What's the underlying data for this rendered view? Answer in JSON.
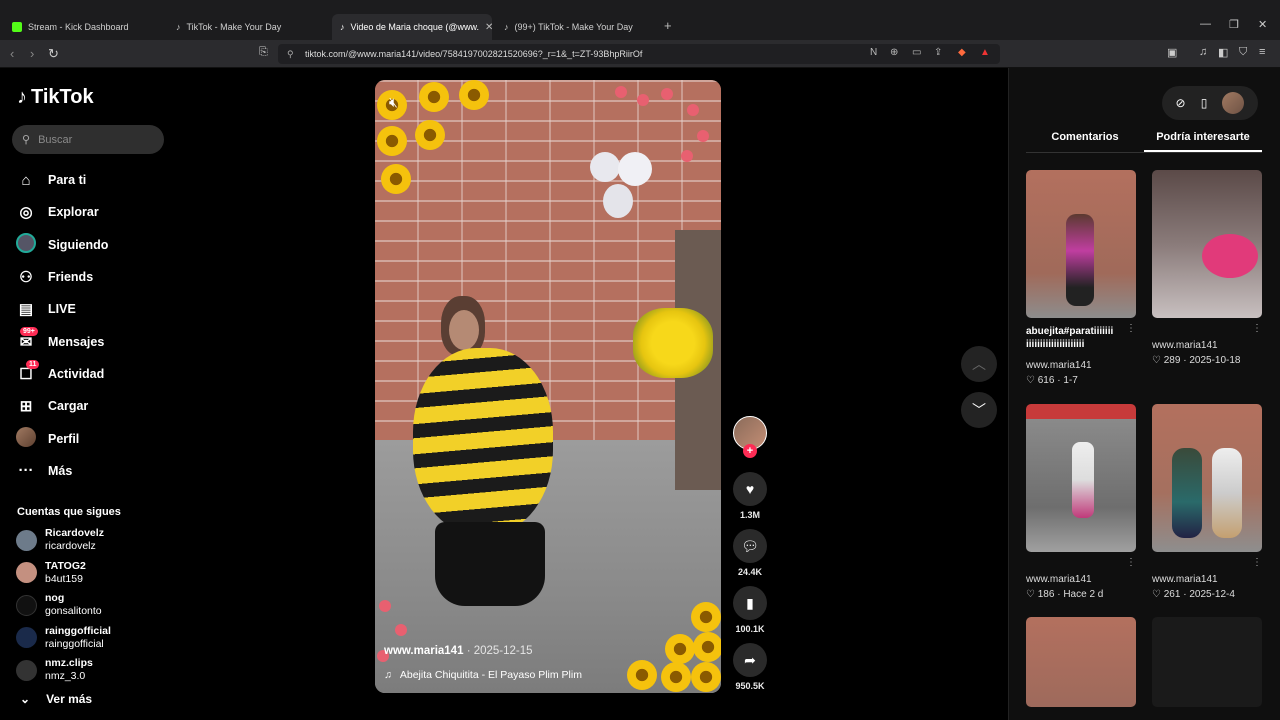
{
  "browser": {
    "tabs": [
      {
        "label": "Stream - Kick Dashboard",
        "favicon_color": "#53fc18"
      },
      {
        "label": "TikTok - Make Your Day",
        "favicon_color": "#ffffff"
      },
      {
        "label": "Video de Maria choque (@www.",
        "favicon_color": "#ffffff"
      },
      {
        "label": "(99+) TikTok - Make Your Day",
        "favicon_color": "#ffffff"
      }
    ],
    "url": "tiktok.com/@www.maria141/video/7584197002821520696?_r=1&_t=ZT-93BhpRiirOf"
  },
  "sidebar": {
    "logo": "TikTok",
    "search_placeholder": "Buscar",
    "nav": [
      {
        "label": "Para ti",
        "icon": "home-icon"
      },
      {
        "label": "Explorar",
        "icon": "compass-icon"
      },
      {
        "label": "Siguiendo",
        "icon": "following-icon"
      },
      {
        "label": "Friends",
        "icon": "friends-icon"
      },
      {
        "label": "LIVE",
        "icon": "live-icon"
      },
      {
        "label": "Mensajes",
        "icon": "messages-icon",
        "badge": "99+"
      },
      {
        "label": "Actividad",
        "icon": "activity-icon",
        "badge": "11"
      },
      {
        "label": "Cargar",
        "icon": "upload-icon"
      },
      {
        "label": "Perfil",
        "icon": "profile-icon"
      },
      {
        "label": "Más",
        "icon": "more-icon"
      }
    ],
    "following_title": "Cuentas que sigues",
    "following": [
      {
        "name": "Ricardovelz",
        "handle": "ricardovelz",
        "color": "#6d7b8a"
      },
      {
        "name": "TATOG2",
        "handle": "b4ut159",
        "color": "#c49080"
      },
      {
        "name": "nog",
        "handle": "gonsalitonto",
        "color": "#111111"
      },
      {
        "name": "rainggofficial",
        "handle": "rainggofficial",
        "color": "#1a2a4a"
      },
      {
        "name": "nmz.clips",
        "handle": "nmz_3.0",
        "color": "#333333"
      }
    ],
    "see_more": "Ver más"
  },
  "video": {
    "username": "www.maria141",
    "date": "2025-12-15",
    "music": "Abejita Chiquitita - El Payaso Plim Plim"
  },
  "actions": {
    "likes": "1.3M",
    "comments": "24.4K",
    "saves": "100.1K",
    "shares": "950.5K"
  },
  "panel": {
    "tabs": [
      "Comentarios",
      "Podría interesarte"
    ],
    "items": [
      {
        "caption": "abuejita#paratiiiiiii iiiiiiiiiiiiiiiiiiiii",
        "user": "www.maria141",
        "likes": "616",
        "when": "1-7"
      },
      {
        "caption": "",
        "user": "www.maria141",
        "likes": "289",
        "when": "2025-10-18"
      },
      {
        "caption": "",
        "user": "www.maria141",
        "likes": "186",
        "when": "Hace 2 d"
      },
      {
        "caption": "",
        "user": "www.maria141",
        "likes": "261",
        "when": "2025-12-4"
      }
    ]
  }
}
